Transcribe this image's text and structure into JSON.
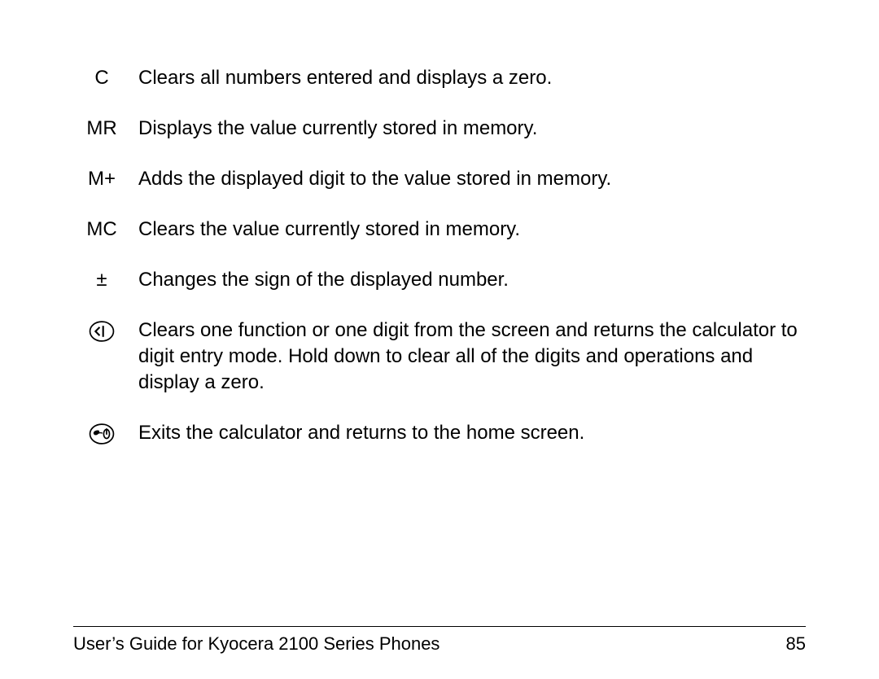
{
  "rows": [
    {
      "key_type": "text",
      "key": "C",
      "desc": "Clears all numbers entered and displays a zero."
    },
    {
      "key_type": "text",
      "key": "MR",
      "desc": "Displays the value currently stored in memory."
    },
    {
      "key_type": "text",
      "key": "M+",
      "desc": "Adds the displayed digit to the value stored in memory."
    },
    {
      "key_type": "text",
      "key": "MC",
      "desc": "Clears the value currently stored in memory."
    },
    {
      "key_type": "text",
      "key": "±",
      "desc": "Changes the sign of the displayed number."
    },
    {
      "key_type": "icon",
      "icon": "back-key-icon",
      "desc": "Clears one function or one digit from the screen and returns the calculator to digit entry mode. Hold down to clear all of the digits and operations and display a zero."
    },
    {
      "key_type": "icon",
      "icon": "end-key-icon",
      "desc": "Exits the calculator and returns to the home screen."
    }
  ],
  "footer": {
    "title": "User’s Guide for Kyocera 2100 Series Phones",
    "page": "85"
  }
}
